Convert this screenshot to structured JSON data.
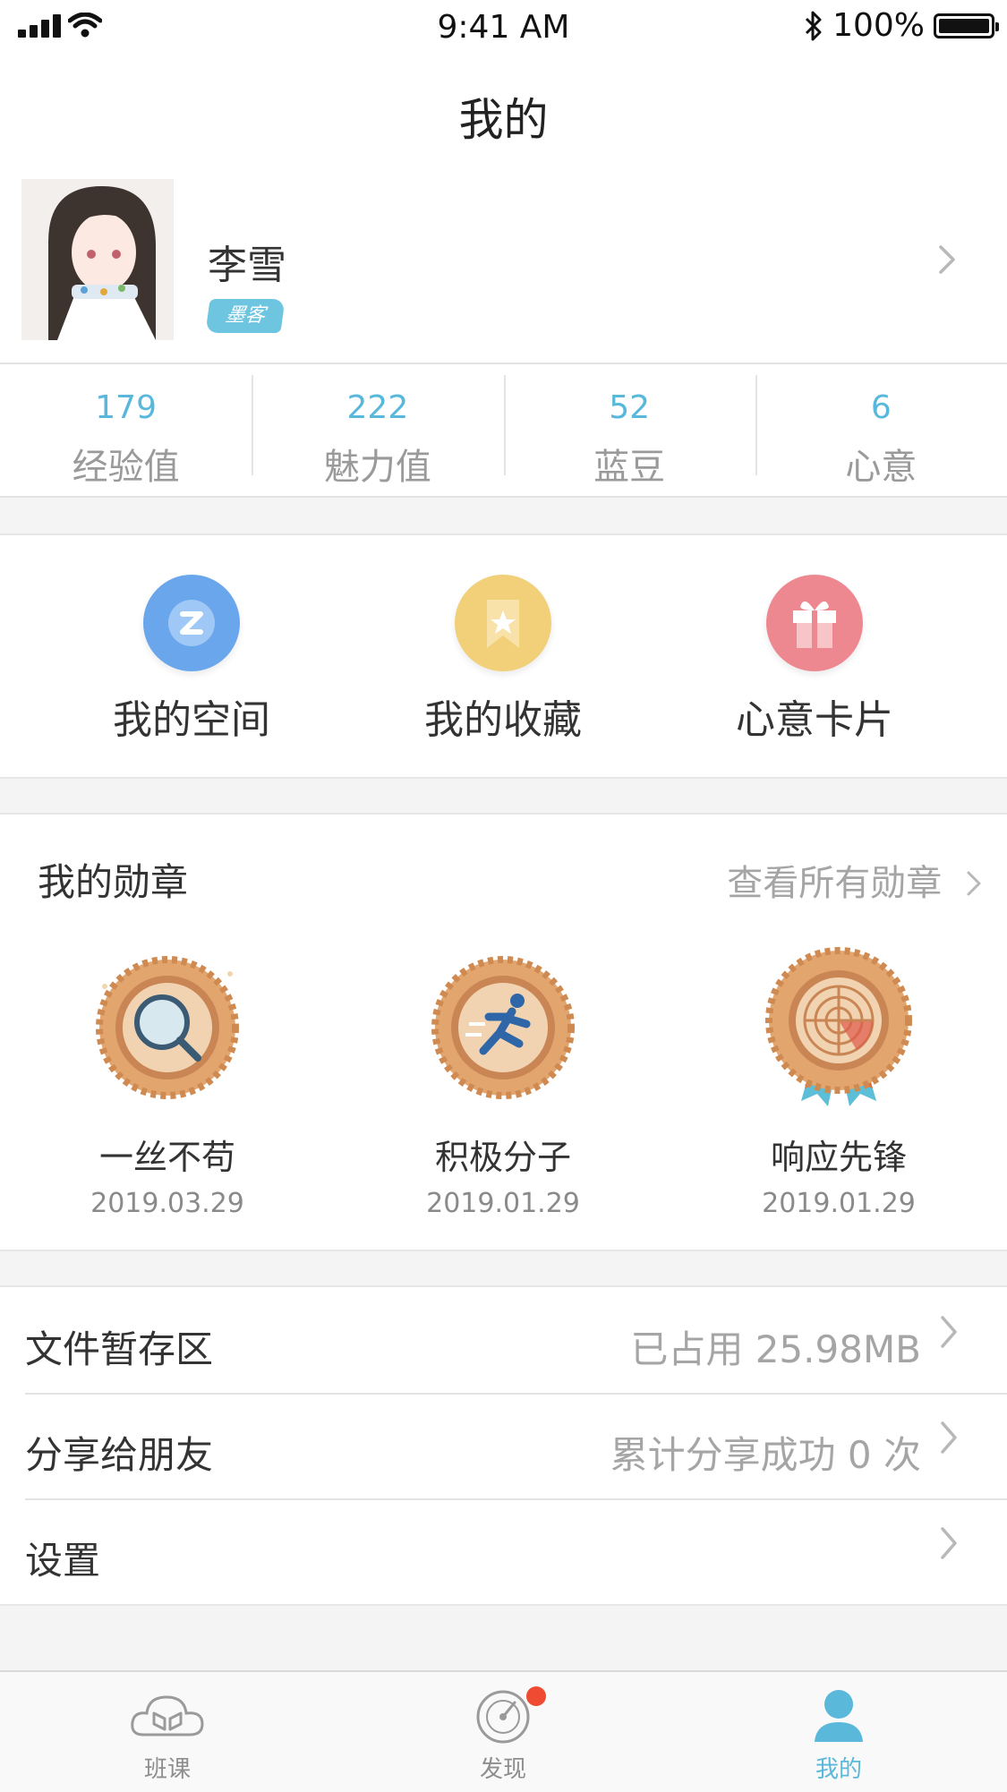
{
  "status_bar": {
    "time": "9:41 AM",
    "battery": "100%"
  },
  "nav": {
    "title": "我的"
  },
  "profile": {
    "name": "李雪",
    "badge": "墨客"
  },
  "stats": [
    {
      "value": "179",
      "label": "经验值"
    },
    {
      "value": "222",
      "label": "魅力值"
    },
    {
      "value": "52",
      "label": "蓝豆"
    },
    {
      "value": "6",
      "label": "心意"
    }
  ],
  "quick_links": [
    {
      "label": "我的空间",
      "icon": "space-icon",
      "color": "#6aa6ec"
    },
    {
      "label": "我的收藏",
      "icon": "bookmark-icon",
      "color": "#f2cf79"
    },
    {
      "label": "心意卡片",
      "icon": "gift-icon",
      "color": "#ee8890"
    }
  ],
  "medals": {
    "title": "我的勋章",
    "view_all": "查看所有勋章",
    "items": [
      {
        "name": "一丝不苟",
        "date": "2019.03.29",
        "icon": "magnifier-medal-icon"
      },
      {
        "name": "积极分子",
        "date": "2019.01.29",
        "icon": "runner-medal-icon"
      },
      {
        "name": "响应先锋",
        "date": "2019.01.29",
        "icon": "radar-medal-icon"
      }
    ]
  },
  "menu": [
    {
      "label": "文件暂存区",
      "value": "已占用 25.98MB"
    },
    {
      "label": "分享给朋友",
      "value": "累计分享成功 0 次"
    },
    {
      "label": "设置",
      "value": ""
    }
  ],
  "tabbar": [
    {
      "label": "班课",
      "icon": "class-icon",
      "active": false
    },
    {
      "label": "发现",
      "icon": "discover-icon",
      "active": false,
      "has_notification": true
    },
    {
      "label": "我的",
      "icon": "profile-icon",
      "active": true
    }
  ],
  "colors": {
    "accent": "#5ab8db",
    "notification": "#ef4b32"
  }
}
